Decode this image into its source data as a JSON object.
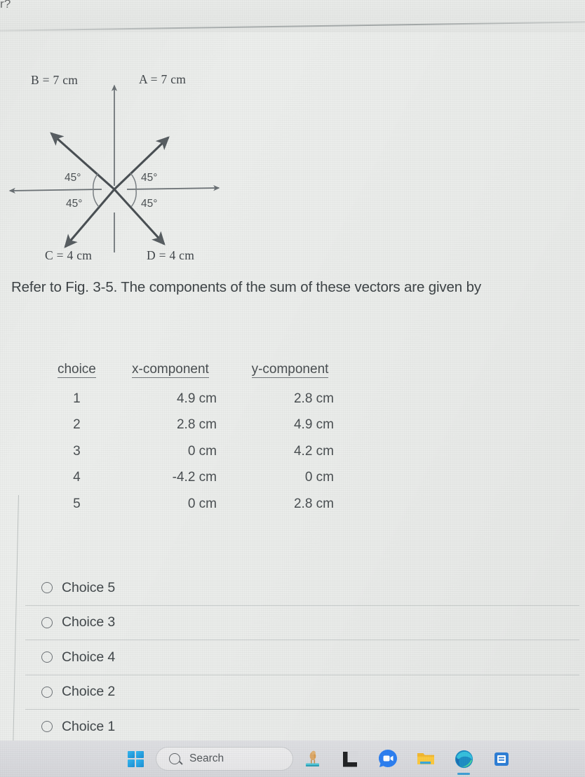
{
  "top_fragment": "r?",
  "figure": {
    "name": "vector-diagram-fig-3-5",
    "vectors": [
      {
        "id": "A",
        "label": "A = 7 cm",
        "magnitude_cm": 7,
        "angle_deg": 45,
        "direction": "up-right"
      },
      {
        "id": "B",
        "label": "B = 7 cm",
        "magnitude_cm": 7,
        "angle_deg": 135,
        "direction": "up-left"
      },
      {
        "id": "C",
        "label": "C = 4 cm",
        "magnitude_cm": 4,
        "angle_deg": 225,
        "direction": "down-left"
      },
      {
        "id": "D",
        "label": "D = 4 cm",
        "magnitude_cm": 4,
        "angle_deg": 315,
        "direction": "down-right"
      }
    ],
    "angle_marks": [
      {
        "label": "45°",
        "quadrant": "upper-left"
      },
      {
        "label": "45°",
        "quadrant": "upper-right"
      },
      {
        "label": "45°",
        "quadrant": "lower-left"
      },
      {
        "label": "45°",
        "quadrant": "lower-right"
      }
    ],
    "axis_color": "#585e62"
  },
  "question": {
    "text": "Refer to Fig. 3-5. The components of the sum of these vectors are given by"
  },
  "table": {
    "headers": {
      "choice": "choice",
      "x": "x-component",
      "y": "y-component"
    },
    "rows": [
      {
        "choice": "1",
        "x": "4.9 cm",
        "y": "2.8 cm"
      },
      {
        "choice": "2",
        "x": "2.8 cm",
        "y": "4.9 cm"
      },
      {
        "choice": "3",
        "x": "0 cm",
        "y": "4.2 cm"
      },
      {
        "choice": "4",
        "x": "-4.2 cm",
        "y": "0 cm"
      },
      {
        "choice": "5",
        "x": "0 cm",
        "y": "2.8 cm"
      }
    ]
  },
  "options": {
    "selected": null,
    "items": [
      {
        "label": "Choice 5",
        "value": "5",
        "selected": false
      },
      {
        "label": "Choice 3",
        "value": "3",
        "selected": false
      },
      {
        "label": "Choice 4",
        "value": "4",
        "selected": false
      },
      {
        "label": "Choice 2",
        "value": "2",
        "selected": false
      },
      {
        "label": "Choice 1",
        "value": "1",
        "selected": false
      }
    ]
  },
  "taskbar": {
    "start_label": "Start",
    "search_placeholder": "Search",
    "apps": [
      {
        "name": "pelican-icon",
        "label": ""
      },
      {
        "name": "lenovo-icon",
        "label": ""
      },
      {
        "name": "zoom-icon",
        "label": ""
      },
      {
        "name": "file-explorer-icon",
        "label": ""
      },
      {
        "name": "edge-icon",
        "label": "",
        "active": true
      },
      {
        "name": "store-icon",
        "label": ""
      }
    ]
  },
  "colors": {
    "page_bg": "#eceeec",
    "text": "#42484b",
    "rule": "#a8aeae",
    "taskbar_bg": "#d9dade",
    "accent_blue": "#3f9fd4"
  }
}
